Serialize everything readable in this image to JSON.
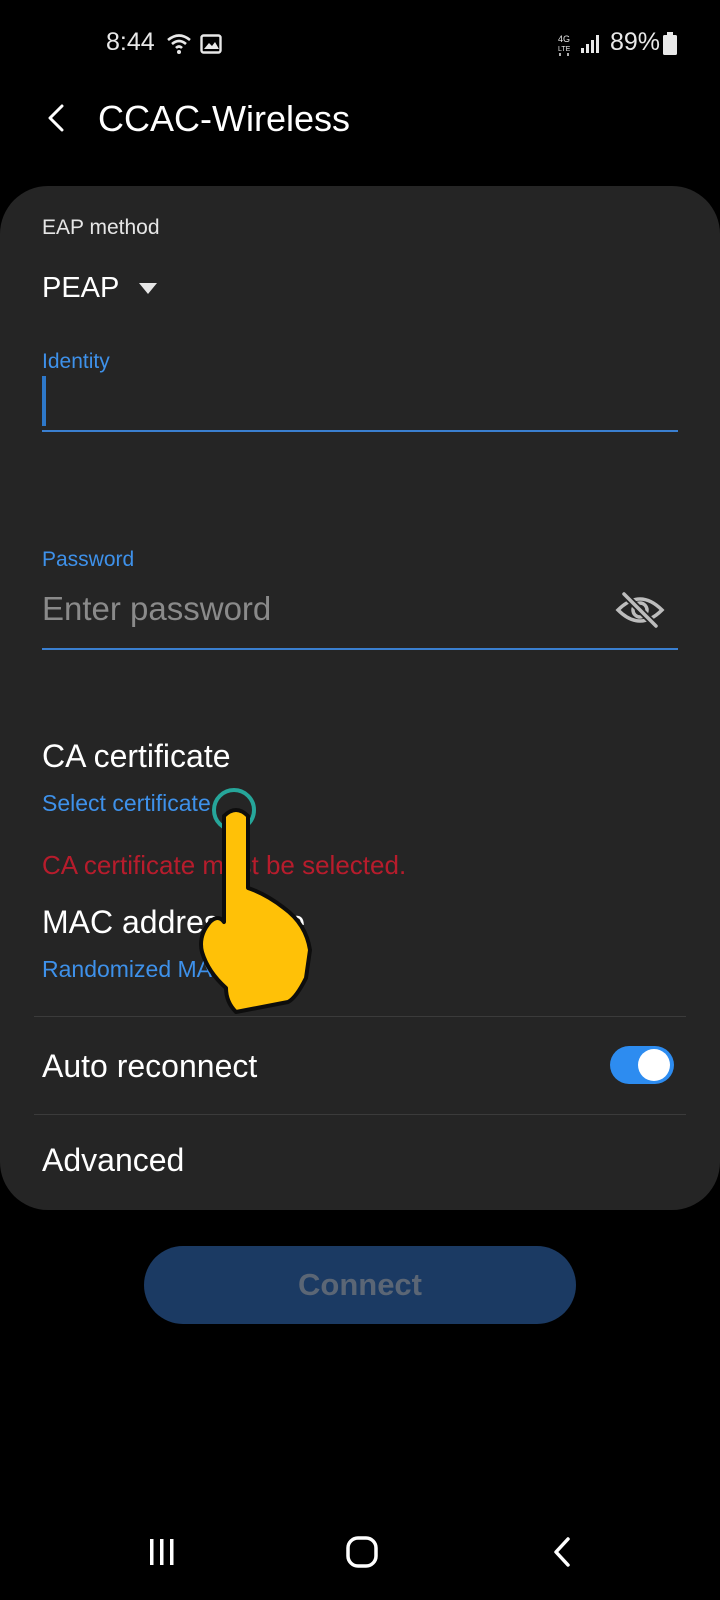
{
  "status": {
    "time": "8:44",
    "battery": "89%",
    "network": "4G LTE"
  },
  "header": {
    "title": "CCAC-Wireless"
  },
  "form": {
    "eap_label": "EAP method",
    "eap_value": "PEAP",
    "identity_label": "Identity",
    "password_label": "Password",
    "password_placeholder": "Enter password",
    "ca_title": "CA certificate",
    "ca_link": "Select certificate",
    "ca_error": "CA certificate must be selected.",
    "mac_title": "MAC address type",
    "mac_value": "Randomized MAC",
    "auto_label": "Auto reconnect",
    "auto_enabled": true,
    "advanced_label": "Advanced"
  },
  "actions": {
    "connect_label": "Connect"
  },
  "colors": {
    "accent": "#3e91ea",
    "error": "#b71c2c",
    "card": "#252525",
    "toggle_on": "#2d8cf0"
  }
}
